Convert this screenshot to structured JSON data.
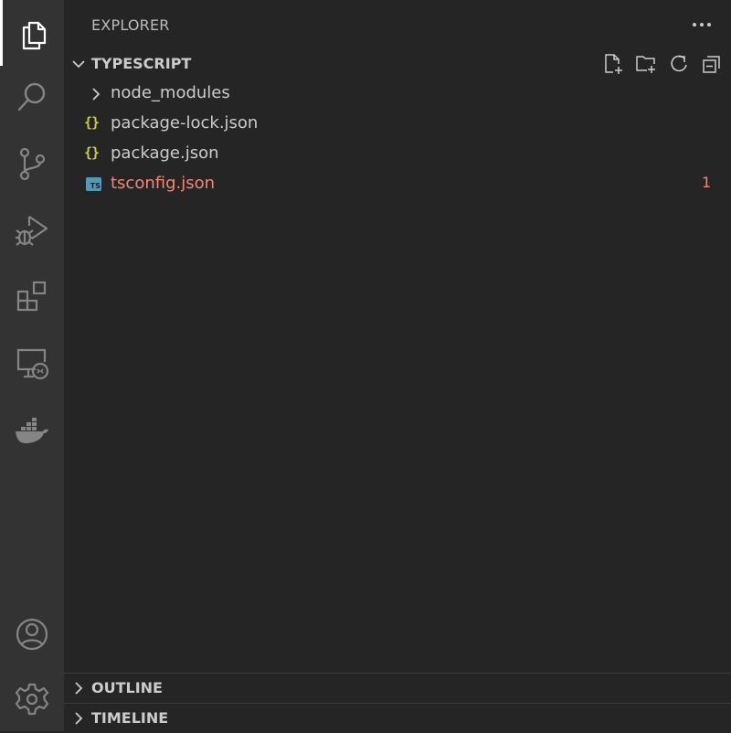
{
  "colors": {
    "activity_bar_bg": "#333333",
    "sidebar_bg": "#252526",
    "text": "#cccccc",
    "icon": "#858585",
    "error": "#f48771",
    "json_icon": "#cbcb41",
    "ts_icon": "#519aba"
  },
  "activity_bar": {
    "items": [
      {
        "icon": "files-icon",
        "active": true
      },
      {
        "icon": "search-icon"
      },
      {
        "icon": "source-control-icon"
      },
      {
        "icon": "run-debug-icon"
      },
      {
        "icon": "extensions-icon"
      },
      {
        "icon": "remote-explorer-icon"
      },
      {
        "icon": "docker-icon"
      }
    ],
    "bottom_items": [
      {
        "icon": "account-icon"
      },
      {
        "icon": "settings-gear-icon"
      }
    ]
  },
  "explorer": {
    "title": "EXPLORER",
    "more_icon": "ellipsis-icon",
    "folder": {
      "name": "TYPESCRIPT",
      "expanded": true,
      "actions": [
        "new-file-icon",
        "new-folder-icon",
        "refresh-icon",
        "collapse-all-icon"
      ]
    },
    "tree": [
      {
        "name": "node_modules",
        "type": "folder",
        "icon": "chevron-right-icon"
      },
      {
        "name": "package-lock.json",
        "type": "json",
        "icon": "{}"
      },
      {
        "name": "package.json",
        "type": "json",
        "icon": "{}"
      },
      {
        "name": "tsconfig.json",
        "type": "ts",
        "icon": "TS",
        "has_error": true,
        "error_count": "1"
      }
    ]
  },
  "panels": {
    "outline": {
      "title": "OUTLINE"
    },
    "timeline": {
      "title": "TIMELINE"
    }
  }
}
